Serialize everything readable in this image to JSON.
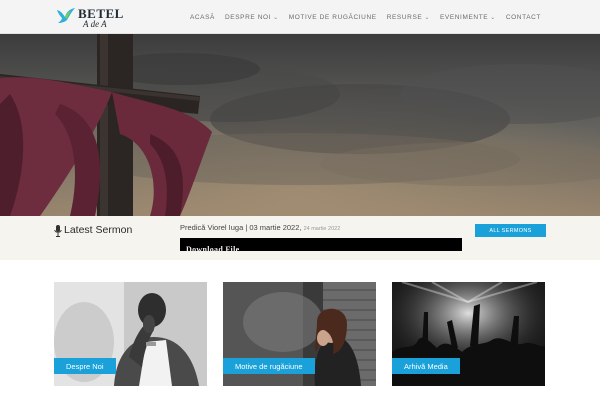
{
  "header": {
    "logo": {
      "brand": "BETEL",
      "subtitle": "A de A",
      "icon": "dove-icon"
    },
    "nav": [
      {
        "label": "ACASĂ",
        "dropdown": false
      },
      {
        "label": "DESPRE NOI",
        "dropdown": true
      },
      {
        "label": "MOTIVE DE RUGĂCIUNE",
        "dropdown": false
      },
      {
        "label": "RESURSE",
        "dropdown": true
      },
      {
        "label": "EVENIMENTE",
        "dropdown": true
      },
      {
        "label": "CONTACT",
        "dropdown": false
      }
    ]
  },
  "hero": {
    "image": "cross-with-purple-cloth-against-cloudy-sky"
  },
  "sermon": {
    "heading": "Latest Sermon",
    "title": "Predică Viorel Iuga | 03 martie 2022,",
    "date_small": "24 martie 2022",
    "download_label": "Download File",
    "all_button": "ALL SERMONS",
    "icon": "microphone-icon"
  },
  "cards": [
    {
      "label": "Despre Noi",
      "image": "man-praying-hands-clasped"
    },
    {
      "label": "Motive de rugăciune",
      "image": "woman-praying-by-brick-wall"
    },
    {
      "label": "Arhivă Media",
      "image": "crowd-worship-concert-lights"
    }
  ],
  "colors": {
    "accent": "#1aa1d9",
    "bar_bg": "#f6f4ef",
    "header_bg": "#f4f4f4"
  }
}
